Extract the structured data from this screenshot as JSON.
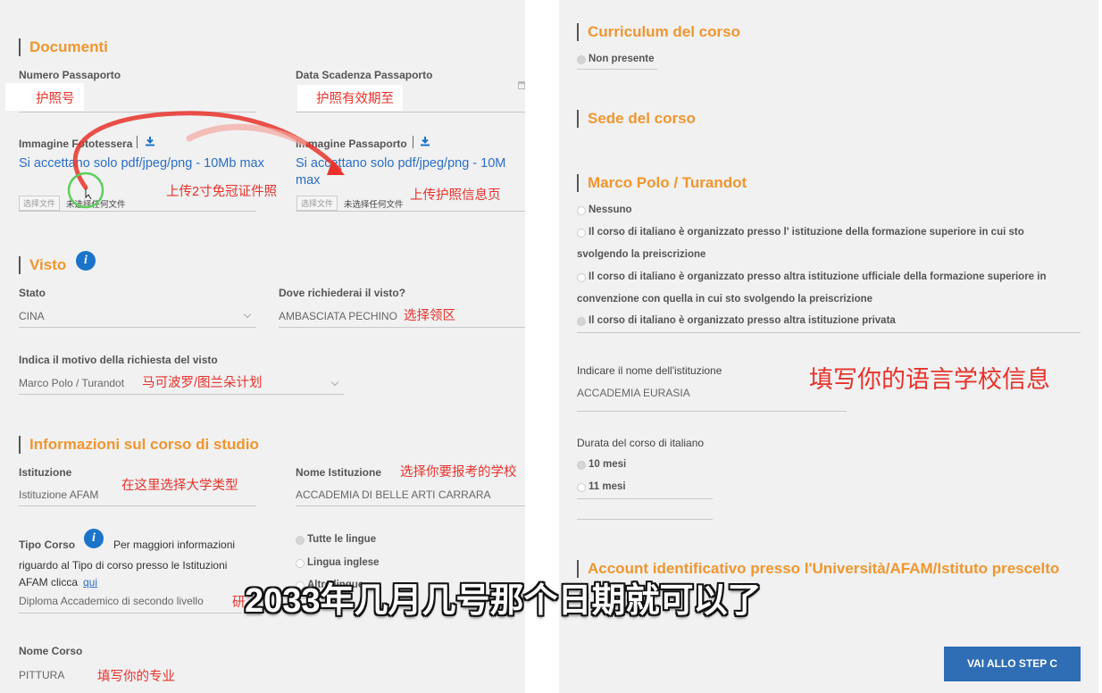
{
  "documenti": {
    "title": "Documenti",
    "passport_number_label": "Numero Passaporto",
    "passport_number_value": "护照号",
    "passport_expiry_label": "Data Scadenza Passaporto",
    "passport_expiry_value": "护照有效期至",
    "photo_label": "Immagine Fototessera",
    "photo_hint": "Si accettano solo pdf/jpeg/png - 10Mb max",
    "photo_choose_button": "选择文件",
    "photo_no_file": "未选择任何文件",
    "photo_note": "上传2寸免冠证件照",
    "passport_image_label": "Immagine Passaporto",
    "passport_image_hint": "Si accettano solo pdf/jpeg/png - 10M max",
    "passport_choose_button": "选择文件",
    "passport_no_file": "未选择任何文件",
    "passport_image_note": "上传护照信息页"
  },
  "visto": {
    "title": "Visto",
    "info_icon": "i",
    "stato_label": "Stato",
    "stato_value": "CINA",
    "dove_label": "Dove richiederai il visto?",
    "dove_value": "AMBASCIATA PECHINO",
    "dove_note": "选择领区",
    "motivo_label": "Indica il motivo della richiesta del visto",
    "motivo_value": "Marco Polo / Turandot",
    "motivo_note": "马可波罗/图兰朵计划"
  },
  "corso": {
    "title": "Informazioni sul corso di studio",
    "istituzione_label": "Istituzione",
    "istituzione_value": "Istituzione AFAM",
    "istituzione_note": "在这里选择大学类型",
    "nome_ist_label": "Nome Istituzione",
    "nome_ist_value": "ACCADEMIA DI BELLE ARTI CARRARA",
    "nome_ist_note": "选择你要报考的学校",
    "tipo_label": "Tipo Corso",
    "info_icon": "i",
    "tipo_info_text_1": "Per maggiori informazioni",
    "tipo_info_text_2": "riguardo al Tipo di corso presso le Istituzioni",
    "tipo_info_text_3": "AFAM clicca",
    "tipo_info_link": "qui",
    "tipo_value": "Diploma Accademico di secondo livello",
    "tipo_note": "研",
    "lingue_options": [
      "Tutte le lingue",
      "Lingua inglese",
      "Altre lingue"
    ],
    "nome_corso_label": "Nome Corso",
    "nome_corso_value": "PITTURA",
    "nome_corso_note": "填写你的专业"
  },
  "curriculum": {
    "title": "Curriculum del corso",
    "option": "Non presente"
  },
  "sede": {
    "title": "Sede del corso"
  },
  "marco_polo": {
    "title": "Marco Polo / Turandot",
    "options": [
      "Nessuno",
      "Il corso di italiano è organizzato presso l'  istituzione della formazione superiore in cui sto",
      "svolgendo la preiscrizione",
      "Il corso di italiano è organizzato presso altra istituzione ufficiale della formazione superiore in",
      "convenzione con quella in cui sto svolgendo la preiscrizione",
      "Il corso di italiano è organizzato presso altra istituzione privata"
    ],
    "nome_ist_label": "Indicare il nome dell'istituzione",
    "nome_ist_value": "ACCADEMIA EURASIA",
    "school_note": "填写你的语言学校信息",
    "durata_label": "Durata del corso di italiano",
    "durata_options": [
      "10 mesi",
      "11 mesi"
    ]
  },
  "account": {
    "title": "Account identificativo presso l'Università/AFAM/Istituto prescelto",
    "partial": "Ac"
  },
  "cta_label": "VAI ALLO STEP C",
  "subtitle": "2033年几月几号那个日期就可以了",
  "colors": {
    "accent_orange": "#f0962e",
    "link_blue": "#2a6ec6",
    "note_red": "#e8322a",
    "button_blue": "#2f6db4"
  }
}
